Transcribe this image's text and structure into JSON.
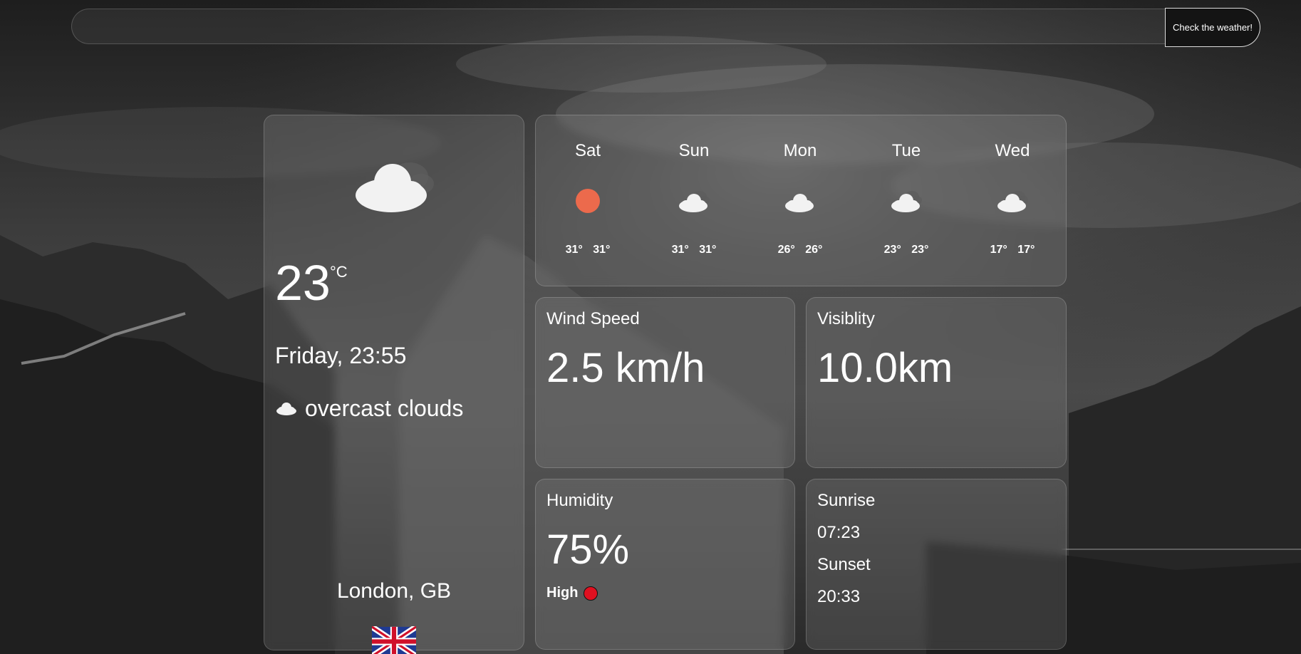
{
  "search": {
    "value": "",
    "placeholder": "",
    "button_label": "Check the weather!"
  },
  "current": {
    "icon": "cloud-icon",
    "temperature": "23",
    "unit": "°C",
    "datetime": "Friday, 23:55",
    "condition": "overcast clouds",
    "condition_icon": "cloud-icon",
    "location": "London, GB",
    "flag": "gb-flag-icon"
  },
  "forecast": [
    {
      "day": "Sat",
      "icon": "sun-icon",
      "temps": "31° 31°"
    },
    {
      "day": "Sun",
      "icon": "cloud-icon",
      "temps": "31° 31°"
    },
    {
      "day": "Mon",
      "icon": "cloud-icon",
      "temps": "26° 26°"
    },
    {
      "day": "Tue",
      "icon": "cloud-icon",
      "temps": "23° 23°"
    },
    {
      "day": "Wed",
      "icon": "cloud-icon",
      "temps": "17° 17°"
    }
  ],
  "wind": {
    "title": "Wind Speed",
    "value": "2.5 km/h"
  },
  "visibility": {
    "title": "Visiblity",
    "value": "10.0km"
  },
  "humidity": {
    "title": "Humidity",
    "value": "75%",
    "level": "High",
    "level_color": "#e01020"
  },
  "sun": {
    "sunrise_label": "Sunrise",
    "sunrise": "07:23",
    "sunset_label": "Sunset",
    "sunset": "20:33"
  },
  "colors": {
    "sun_icon": "#ec6a4c",
    "card_bg": "rgba(150,150,150,0.22)"
  }
}
